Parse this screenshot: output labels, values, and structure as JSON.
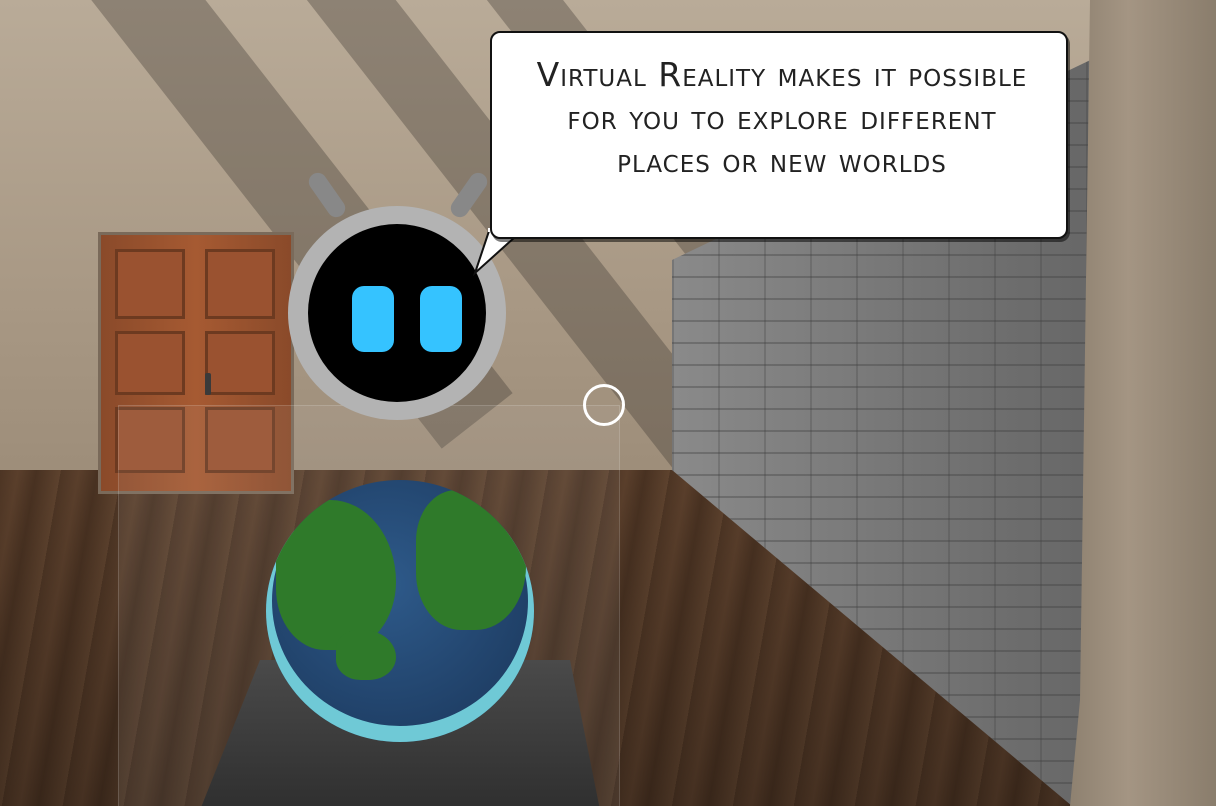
{
  "dialogue": {
    "speaker_icon": "robot-guide-icon",
    "text": "Virtual Reality makes it possible for you to explore different places or new worlds"
  },
  "scene": {
    "objects": [
      "door-icon",
      "globe-icon",
      "robot-icon",
      "gaze-reticle-icon"
    ]
  },
  "colors": {
    "robot_eye": "#35c3ff",
    "robot_face": "#000000",
    "robot_head": "#b3b3b3",
    "globe_ocean": "#1f3f66",
    "globe_land": "#2f7a2a",
    "reticle": "#ffffff"
  }
}
